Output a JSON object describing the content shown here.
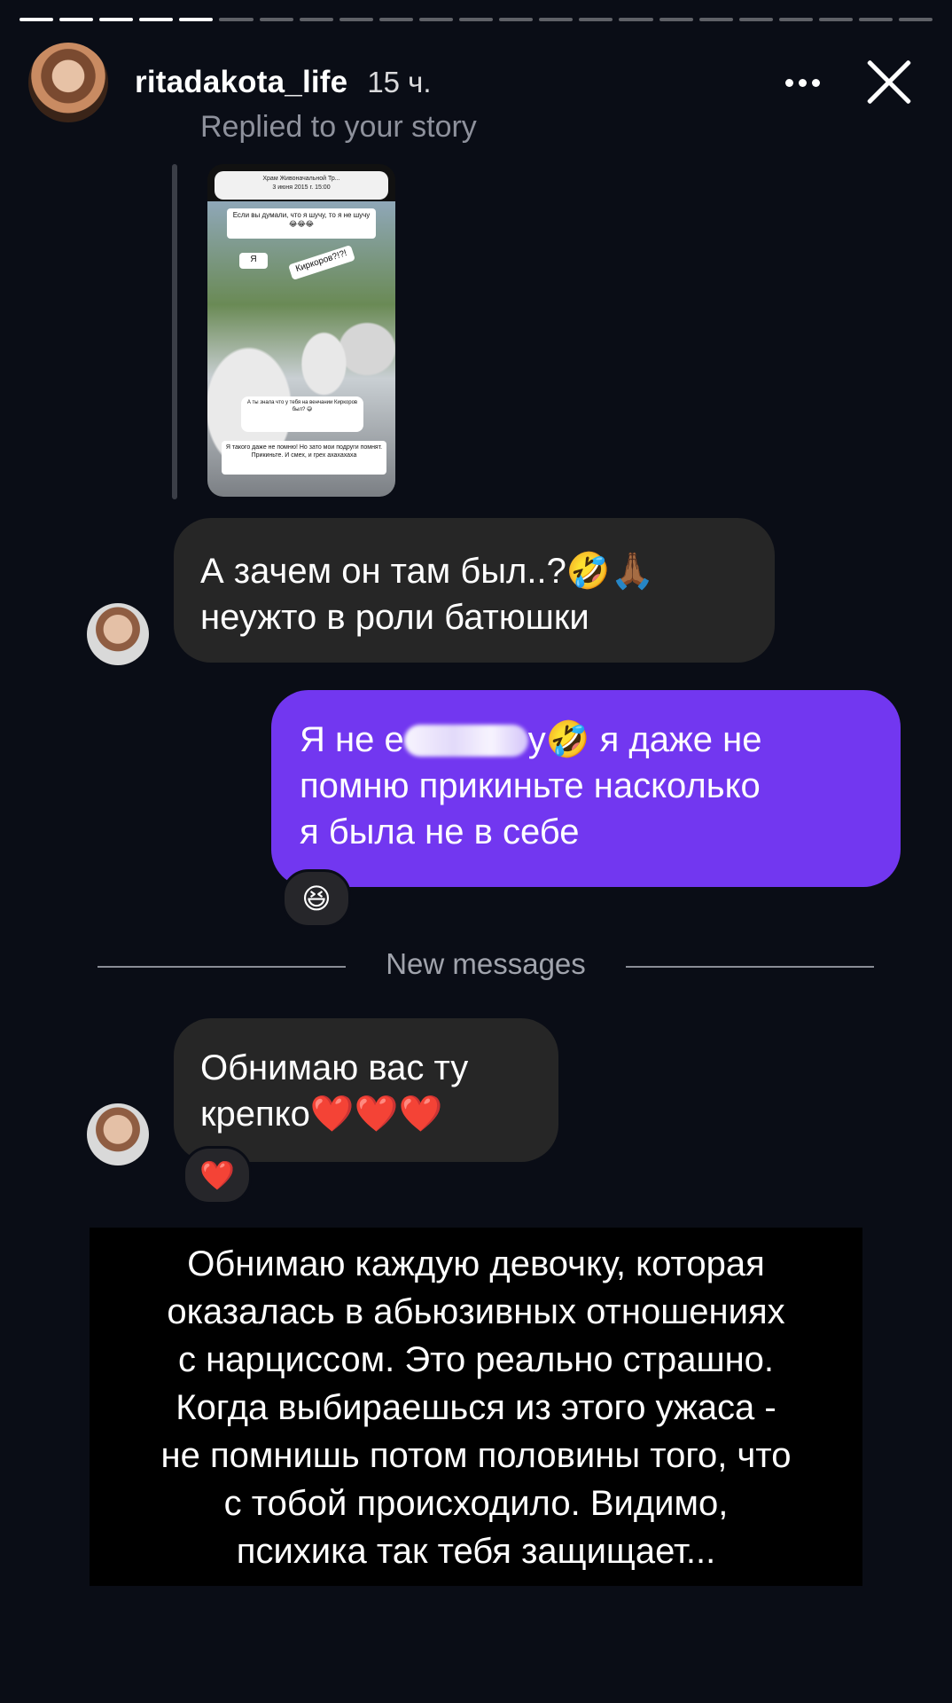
{
  "story": {
    "segments_total": 23,
    "segments_completed": 5
  },
  "header": {
    "username": "ritadakota_life",
    "time": "15 ч.",
    "more_icon": "more-horizontal-icon",
    "close_icon": "close-icon"
  },
  "reply": {
    "label": "Replied to your story",
    "thumb": {
      "top_title": "Храм Живоначальной Тр...",
      "top_sub": "3 июня 2015 г. 15:00",
      "card1": "Если вы думали, что я шучу, то я не шучу😂😂😂",
      "card2": "Я",
      "card3": "Киркоров?!?!",
      "card4": "А ты знала что у тебя на венчании Киркоров был? 😅",
      "card5": "Я такого даже не помню! Но зато мои подруги помнят. Прикиньте. И смех, и грех ахахахаха"
    }
  },
  "messages": [
    {
      "type": "incoming",
      "lines": [
        "А зачем он там был..?🤣🙏🏾",
        "неужто в роли батюшки"
      ]
    },
    {
      "type": "outgoing",
      "line1_start": "Я не е",
      "line1_end": "у🤣 я даже не",
      "line2": "помню прикиньте насколько",
      "line3": "я была не в себе",
      "reaction": "😆"
    },
    {
      "type": "incoming",
      "lines": [
        "Обнимаю вас ту",
        "крепко❤️❤️❤️"
      ],
      "reaction": "❤️"
    }
  ],
  "divider": {
    "label": "New messages"
  },
  "caption": {
    "lines": [
      "Обнимаю каждую девочку, которая",
      "оказалась в абьюзивных отношениях",
      "с нарциссом. Это реально страшно.",
      "Когда выбираешься из этого ужаса -",
      "не помнишь потом половины того, что",
      "с тобой происходило. Видимо,",
      "психика так тебя защищает..."
    ]
  },
  "colors": {
    "background": "#0a0d16",
    "incoming_bubble": "#262626",
    "outgoing_bubble": "#7237f0"
  }
}
